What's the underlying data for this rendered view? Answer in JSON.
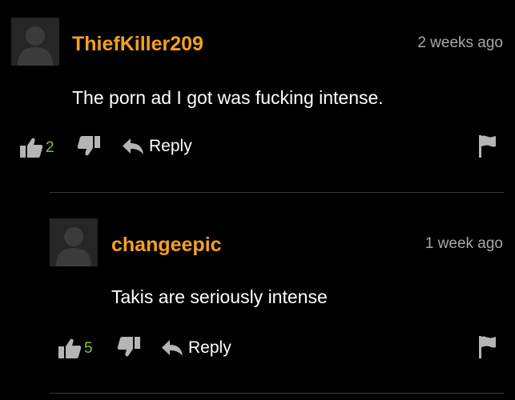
{
  "colors": {
    "background": "#000000",
    "username": "#f5a022",
    "text": "#ffffff",
    "muted": "#a9a9a9",
    "count": "#8fbf2f",
    "icon": "#b5b5b5",
    "avatar_bg": "#262626",
    "avatar_fg": "#3b3b3b"
  },
  "comments": [
    {
      "username": "ThiefKiller209",
      "timestamp": "2 weeks ago",
      "text": "The porn ad I got was fucking intense.",
      "likes": "2",
      "reply_label": "Reply",
      "icons": {
        "like": "thumbs-up-icon",
        "dislike": "thumbs-down-icon",
        "reply": "reply-arrow-icon",
        "flag": "flag-icon"
      }
    },
    {
      "username": "changeepic",
      "timestamp": "1 week ago",
      "text": "Takis are seriously intense",
      "likes": "5",
      "reply_label": "Reply",
      "icons": {
        "like": "thumbs-up-icon",
        "dislike": "thumbs-down-icon",
        "reply": "reply-arrow-icon",
        "flag": "flag-icon"
      }
    }
  ]
}
